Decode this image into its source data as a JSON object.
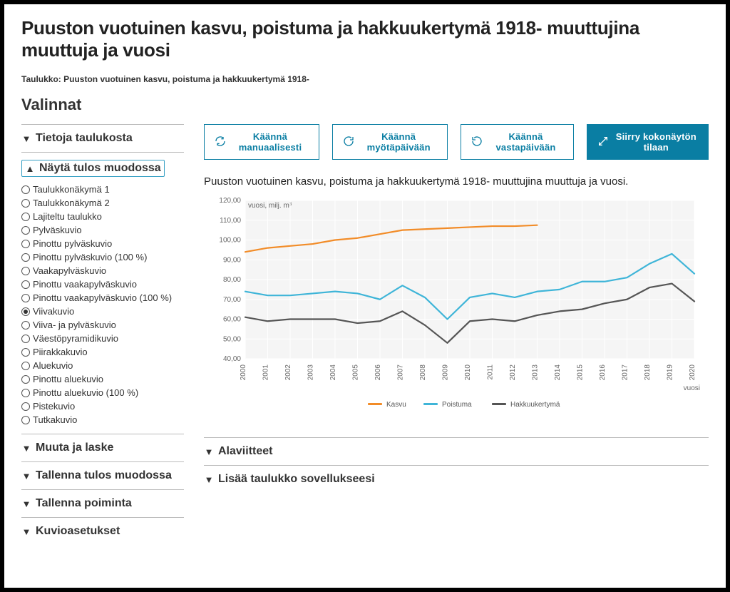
{
  "header": {
    "title": "Puuston vuotuinen kasvu, poistuma ja hakkuukertymä 1918- muuttujina muuttuja ja vuosi",
    "subtitle_prefix": "Taulukko: ",
    "subtitle": "Puuston vuotuinen kasvu, poistuma ja hakkuukertymä 1918-",
    "valinnat": "Valinnat"
  },
  "sidebar": {
    "items": [
      {
        "label": "Tietoja taulukosta",
        "open": false
      },
      {
        "label": "Näytä tulos muodossa",
        "open": true,
        "options": [
          "Taulukkonäkymä 1",
          "Taulukkonäkymä 2",
          "Lajiteltu taulukko",
          "Pylväskuvio",
          "Pinottu pylväskuvio",
          "Pinottu pylväskuvio (100 %)",
          "Vaakapylväskuvio",
          "Pinottu vaakapylväskuvio",
          "Pinottu vaakapylväskuvio (100 %)",
          "Viivakuvio",
          "Viiva- ja pylväskuvio",
          "Väestöpyramidikuvio",
          "Piirakkakuvio",
          "Aluekuvio",
          "Pinottu aluekuvio",
          "Pinottu aluekuvio (100 %)",
          "Pistekuvio",
          "Tutkakuvio"
        ],
        "selected": "Viivakuvio"
      },
      {
        "label": "Muuta ja laske",
        "open": false
      },
      {
        "label": "Tallenna tulos muodossa",
        "open": false
      },
      {
        "label": "Tallenna poiminta",
        "open": false
      },
      {
        "label": "Kuvioasetukset",
        "open": false
      }
    ]
  },
  "toolbar": {
    "rotate_manual": "Käännä manuaalisesti",
    "rotate_cw": "Käännä myötäpäivään",
    "rotate_ccw": "Käännä vastapäivään",
    "fullscreen": "Siirry kokonäytön tilaan"
  },
  "chart_area": {
    "title": "Puuston vuotuinen kasvu, poistuma ja hakkuukertymä 1918- muuttujina muuttuja ja vuosi.",
    "y_axis_label": "vuosi, milj. m³",
    "x_axis_label": "vuosi"
  },
  "collapsibles": {
    "footnotes": "Alaviitteet",
    "embed": "Lisää taulukko sovellukseesi"
  },
  "chart_data": {
    "type": "line",
    "title": "Puuston vuotuinen kasvu, poistuma ja hakkuukertymä 1918- muuttujina muuttuja ja vuosi.",
    "xlabel": "vuosi",
    "ylabel": "vuosi, milj. m³",
    "ylim": [
      40,
      120
    ],
    "y_ticks": [
      40,
      50,
      60,
      70,
      80,
      90,
      100,
      110,
      120
    ],
    "categories": [
      "2000",
      "2001",
      "2002",
      "2003",
      "2004",
      "2005",
      "2006",
      "2007",
      "2008",
      "2009",
      "2010",
      "2011",
      "2012",
      "2013",
      "2014",
      "2015",
      "2016",
      "2017",
      "2018",
      "2019",
      "2020"
    ],
    "series": [
      {
        "name": "Kasvu",
        "color": "#f28c28",
        "values": [
          94,
          96,
          97,
          98,
          100,
          101,
          103,
          105,
          105.5,
          106,
          106.5,
          107,
          107,
          107.5,
          null,
          null,
          null,
          null,
          null,
          null,
          null
        ]
      },
      {
        "name": "Poistuma",
        "color": "#3fb5d8",
        "values": [
          74,
          72,
          72,
          73,
          74,
          73,
          70,
          77,
          71,
          60,
          71,
          73,
          71,
          74,
          75,
          79,
          79,
          81,
          88,
          93,
          83
        ]
      },
      {
        "name": "Hakkuukertymä",
        "color": "#555555",
        "values": [
          61,
          59,
          60,
          60,
          60,
          58,
          59,
          64,
          57,
          48,
          59,
          60,
          59,
          62,
          64,
          65,
          68,
          70,
          76,
          78,
          69
        ]
      }
    ],
    "legend_position": "bottom",
    "grid": true
  }
}
